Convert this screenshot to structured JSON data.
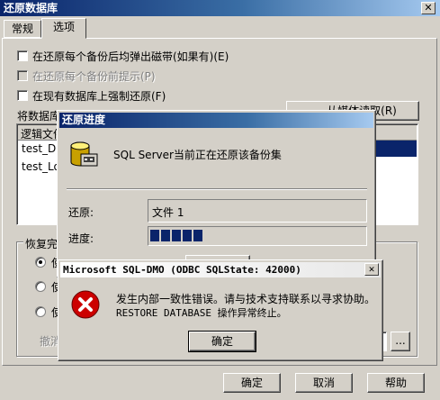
{
  "main_window": {
    "title": "还原数据库",
    "tabs": [
      {
        "label": "常规"
      },
      {
        "label": "选项"
      }
    ],
    "options": [
      {
        "label": "在还原每个备份后均弹出磁带(如果有)(E)",
        "checked": false,
        "enabled": true
      },
      {
        "label": "在还原每个备份前提示(P)",
        "checked": false,
        "enabled": false
      },
      {
        "label": "在现有数据库上强制还原(F)",
        "checked": false,
        "enabled": true
      }
    ],
    "db_files_label": "将数据库",
    "files_header": "逻辑文件",
    "files": [
      "test_Dat",
      "test_Log"
    ],
    "recovery_label": "恢复完",
    "radio_partial": [
      "使",
      "使",
      "使"
    ],
    "undo_label": "撤消",
    "reload_button_label": "从媒体读取(R)",
    "ok_label": "确定",
    "cancel_label": "取消",
    "help_label": "帮助",
    "browse_label": "..."
  },
  "progress_dialog": {
    "title": "还原进度",
    "message": "SQL Server当前正在还原该备份集",
    "restore_label": "还原:",
    "restore_value": "文件 1",
    "progress_label": "进度:",
    "progress_blocks": 5
  },
  "error_dialog": {
    "title": "Microsoft SQL-DMO (ODBC SQLState: 42000)",
    "line1": "发生内部一致性错误。请与技术支持联系以寻求协助。",
    "line2": "RESTORE DATABASE 操作异常终止。",
    "ok_label": "确定",
    "close_label": "✕"
  },
  "colors": {
    "titlebar": "#0a246a",
    "face": "#d4d0c8",
    "error": "#cc0000",
    "selection": "#0a246a"
  }
}
